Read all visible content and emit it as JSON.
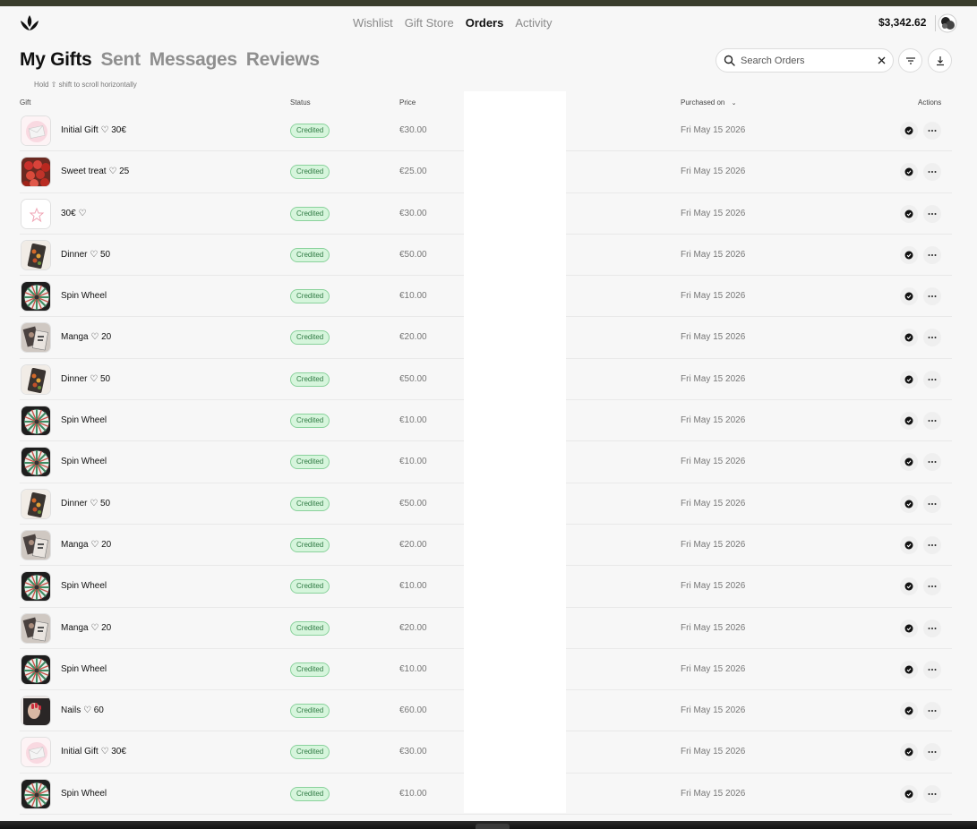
{
  "header": {
    "nav": [
      "Wishlist",
      "Gift Store",
      "Orders",
      "Activity"
    ],
    "active_nav": "Orders",
    "balance": "$3,342.62"
  },
  "tabs": [
    "My Gifts",
    "Sent",
    "Messages",
    "Reviews"
  ],
  "active_tab": "My Gifts",
  "hint": "Hold ⇧ shift to scroll horizontally",
  "search": {
    "placeholder": "Search Orders"
  },
  "columns": {
    "gift": "Gift",
    "status": "Status",
    "price": "Price",
    "purchased": "Purchased on",
    "actions": "Actions"
  },
  "orders": [
    {
      "name": "Initial Gift ♡ 30€",
      "thumb": "envelope",
      "status": "Credited",
      "price": "€30.00",
      "date": "Fri May 15 2026"
    },
    {
      "name": "Sweet treat ♡ 25",
      "thumb": "strawberries",
      "status": "Credited",
      "price": "€25.00",
      "date": "Fri May 15 2026"
    },
    {
      "name": "30€ ♡",
      "thumb": "star",
      "status": "Credited",
      "price": "€30.00",
      "date": "Fri May 15 2026"
    },
    {
      "name": "Dinner ♡ 50",
      "thumb": "dinner",
      "status": "Credited",
      "price": "€50.00",
      "date": "Fri May 15 2026"
    },
    {
      "name": "Spin Wheel",
      "thumb": "wheel",
      "status": "Credited",
      "price": "€10.00",
      "date": "Fri May 15 2026"
    },
    {
      "name": "Manga ♡ 20",
      "thumb": "manga",
      "status": "Credited",
      "price": "€20.00",
      "date": "Fri May 15 2026"
    },
    {
      "name": "Dinner ♡ 50",
      "thumb": "dinner",
      "status": "Credited",
      "price": "€50.00",
      "date": "Fri May 15 2026"
    },
    {
      "name": "Spin Wheel",
      "thumb": "wheel",
      "status": "Credited",
      "price": "€10.00",
      "date": "Fri May 15 2026"
    },
    {
      "name": "Spin Wheel",
      "thumb": "wheel",
      "status": "Credited",
      "price": "€10.00",
      "date": "Fri May 15 2026"
    },
    {
      "name": "Dinner ♡ 50",
      "thumb": "dinner",
      "status": "Credited",
      "price": "€50.00",
      "date": "Fri May 15 2026"
    },
    {
      "name": "Manga ♡ 20",
      "thumb": "manga",
      "status": "Credited",
      "price": "€20.00",
      "date": "Fri May 15 2026"
    },
    {
      "name": "Spin Wheel",
      "thumb": "wheel",
      "status": "Credited",
      "price": "€10.00",
      "date": "Fri May 15 2026"
    },
    {
      "name": "Manga ♡ 20",
      "thumb": "manga",
      "status": "Credited",
      "price": "€20.00",
      "date": "Fri May 15 2026"
    },
    {
      "name": "Spin Wheel",
      "thumb": "wheel",
      "status": "Credited",
      "price": "€10.00",
      "date": "Fri May 15 2026"
    },
    {
      "name": "Nails ♡ 60",
      "thumb": "nails",
      "status": "Credited",
      "price": "€60.00",
      "date": "Fri May 15 2026"
    },
    {
      "name": "Initial Gift ♡ 30€",
      "thumb": "envelope",
      "status": "Credited",
      "price": "€30.00",
      "date": "Fri May 15 2026"
    },
    {
      "name": "Spin Wheel",
      "thumb": "wheel",
      "status": "Credited",
      "price": "€10.00",
      "date": "Fri May 15 2026"
    }
  ],
  "colors": {
    "badge_bg": "#d6f5dc",
    "badge_text": "#2f7a43",
    "badge_border": "#8ad29c"
  }
}
